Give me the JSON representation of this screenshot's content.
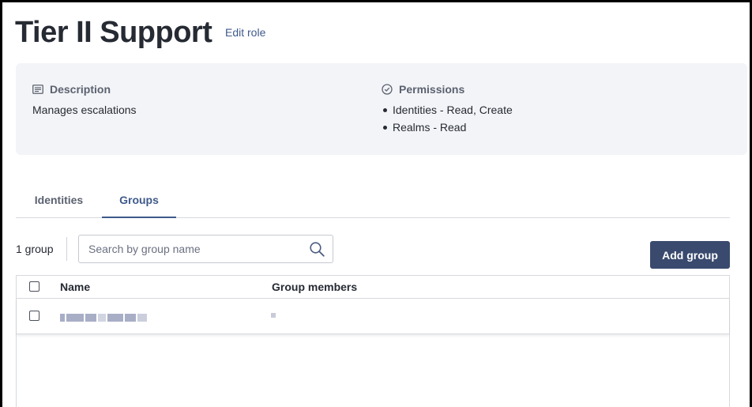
{
  "header": {
    "title": "Tier II Support",
    "edit_label": "Edit role"
  },
  "description": {
    "heading": "Description",
    "text": "Manages escalations",
    "icon": "document-icon"
  },
  "permissions": {
    "heading": "Permissions",
    "icon": "check-circle-icon",
    "items": [
      "Identities - Read, Create",
      "Realms - Read"
    ]
  },
  "tabs": [
    {
      "label": "Identities",
      "active": false
    },
    {
      "label": "Groups",
      "active": true
    }
  ],
  "toolbar": {
    "count_label": "1 group",
    "search_placeholder": "Search by group name",
    "add_button": "Add group"
  },
  "table": {
    "columns": [
      "Name",
      "Group members"
    ],
    "rows": [
      {
        "name": "",
        "members": "",
        "redacted": true
      }
    ]
  },
  "colors": {
    "accent": "#3f5a8a",
    "button": "#3a4a6e",
    "panel": "#f3f4f7"
  }
}
